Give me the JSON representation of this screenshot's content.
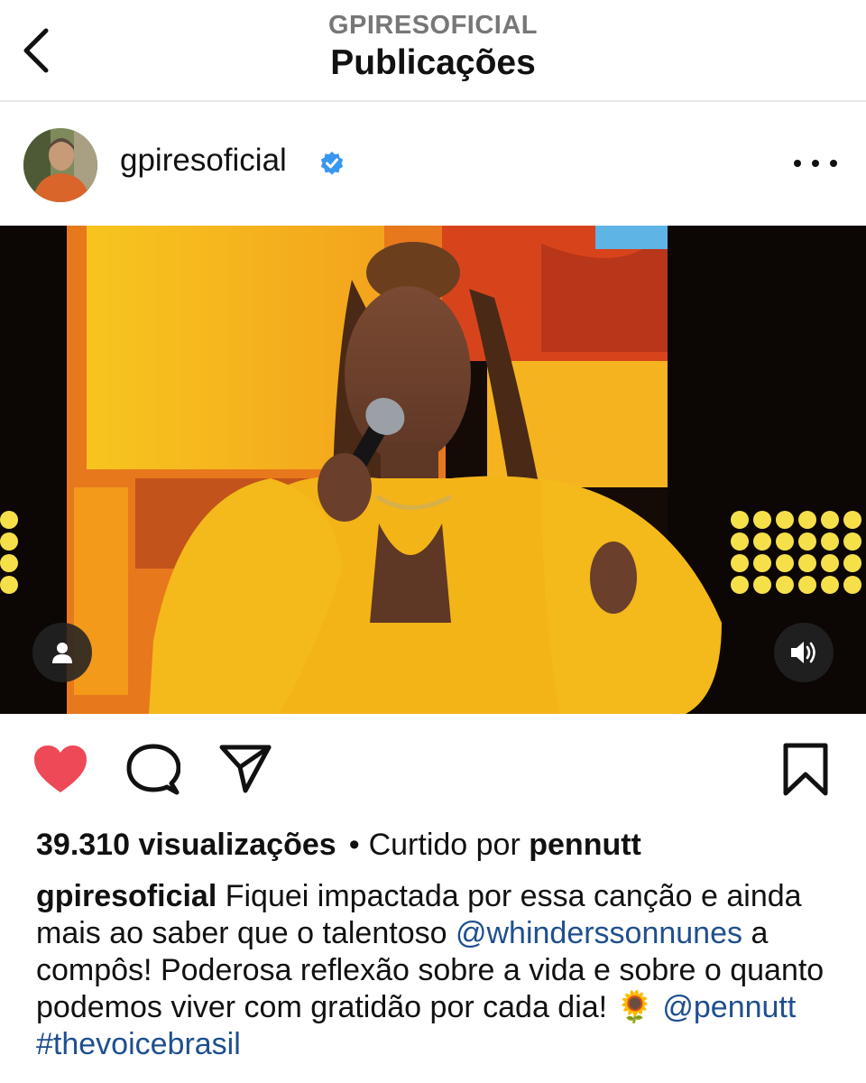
{
  "header": {
    "subtitle": "GPIRESOFICIAL",
    "title": "Publicações",
    "back_icon": "chevron-left-icon"
  },
  "post": {
    "username": "gpiresoficial",
    "verified": true,
    "accent_verified": "#3897f0",
    "more_icon": "more-horizontal-icon"
  },
  "media": {
    "type": "video",
    "tag_icon": "user-tag-icon",
    "sound_icon": "volume-icon"
  },
  "actions": {
    "like_icon": "heart-filled-icon",
    "like_color": "#ed4956",
    "comment_icon": "comment-icon",
    "share_icon": "send-icon",
    "save_icon": "bookmark-icon"
  },
  "stats": {
    "views": "39.310 visualizações",
    "separator": "•",
    "liked_by_prefix": "Curtido por",
    "liked_by_user": "pennutt"
  },
  "caption": {
    "author": "gpiresoficial",
    "text_part1": "Fiquei impactada por essa canção e ainda mais ao saber que o talentoso",
    "mention1": "@whinderssonnunes",
    "text_part2": "a compôs! Poderosa reflexão sobre a vida e sobre o quanto podemos viver com gratidão por cada dia! 🌻",
    "mention2": "@pennutt",
    "hashtag": "#thevoicebrasil",
    "link_color": "#1f4f8f"
  }
}
